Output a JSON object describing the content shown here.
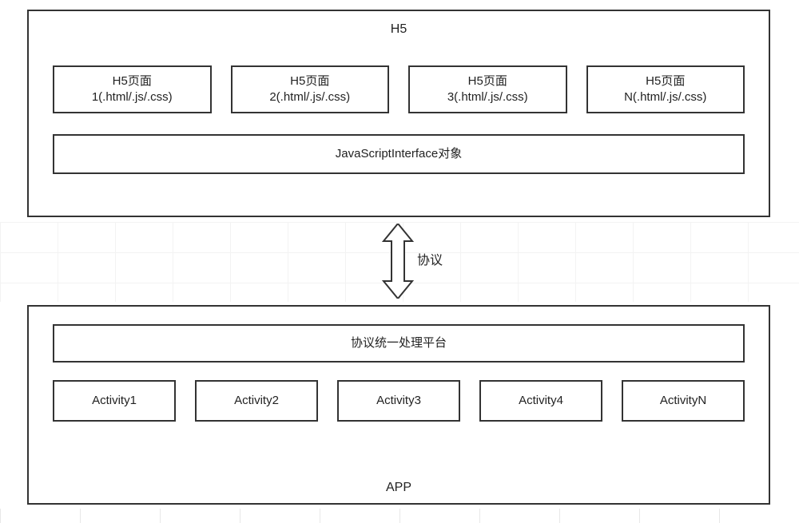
{
  "top": {
    "title": "H5",
    "pages": [
      {
        "name": "H5页面",
        "file": "1(.html/.js/.css)"
      },
      {
        "name": "H5页面",
        "file": "2(.html/.js/.css)"
      },
      {
        "name": "H5页面",
        "file": "3(.html/.js/.css)"
      },
      {
        "name": "H5页面",
        "file": "N(.html/.js/.css)"
      }
    ],
    "jsInterface": "JavaScriptInterface对象"
  },
  "connector": {
    "label": "协议"
  },
  "bottom": {
    "title": "APP",
    "platform": "协议统一处理平台",
    "activities": [
      "Activity1",
      "Activity2",
      "Activity3",
      "Activity4",
      "ActivityN"
    ]
  }
}
